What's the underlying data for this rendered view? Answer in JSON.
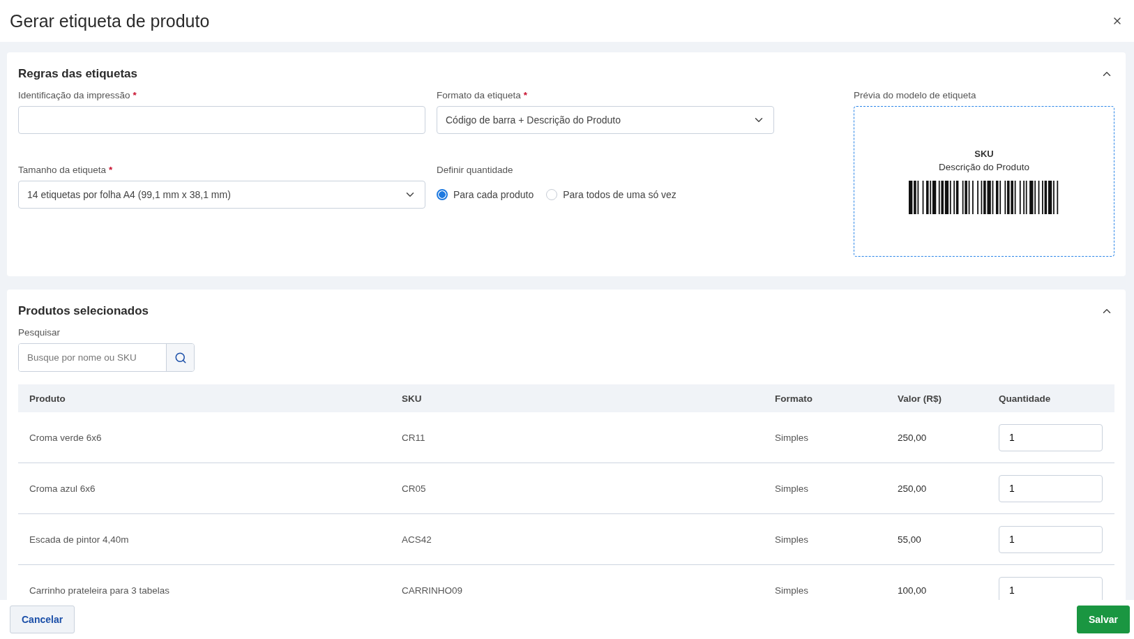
{
  "dialog": {
    "title": "Gerar etiqueta de produto"
  },
  "rules_section": {
    "title": "Regras das etiquetas",
    "expanded": true,
    "print_id": {
      "label": "Identificação da impressão",
      "required_mark": "*"
    },
    "label_format": {
      "label": "Formato da etiqueta",
      "required_mark": "*",
      "value": "Código de barra + Descrição do Produto"
    },
    "label_size": {
      "label": "Tamanho da etiqueta",
      "required_mark": "*",
      "value": "14 etiquetas por folha A4 (99,1 mm x 38,1 mm)"
    },
    "quantity_mode": {
      "label": "Definir quantidade",
      "options": [
        {
          "label": "Para cada produto",
          "selected": true
        },
        {
          "label": "Para todos de uma só vez",
          "selected": false
        }
      ]
    },
    "preview": {
      "label": "Prévia do modelo de etiqueta",
      "sku": "SKU",
      "description": "Descrição do Produto"
    }
  },
  "products_section": {
    "title": "Produtos selecionados",
    "expanded": true,
    "search": {
      "label": "Pesquisar",
      "placeholder": "Busque por nome ou SKU"
    },
    "table": {
      "columns": [
        "Produto",
        "SKU",
        "Formato",
        "Valor (R$)",
        "Quantidade"
      ],
      "rows": [
        {
          "product": "Croma verde 6x6",
          "sku": "CR11",
          "format": "Simples",
          "value": "250,00",
          "quantity": "1"
        },
        {
          "product": "Croma azul 6x6",
          "sku": "CR05",
          "format": "Simples",
          "value": "250,00",
          "quantity": "1"
        },
        {
          "product": "Escada de pintor 4,40m",
          "sku": "ACS42",
          "format": "Simples",
          "value": "55,00",
          "quantity": "1"
        },
        {
          "product": "Carrinho prateleira para 3 tabelas",
          "sku": "CARRINHO09",
          "format": "Simples",
          "value": "100,00",
          "quantity": "1"
        }
      ]
    }
  },
  "footer": {
    "buttons": [
      {
        "label": "Cancelar",
        "kind": "secondary"
      },
      {
        "label": "Salvar",
        "kind": "primary"
      }
    ]
  }
}
